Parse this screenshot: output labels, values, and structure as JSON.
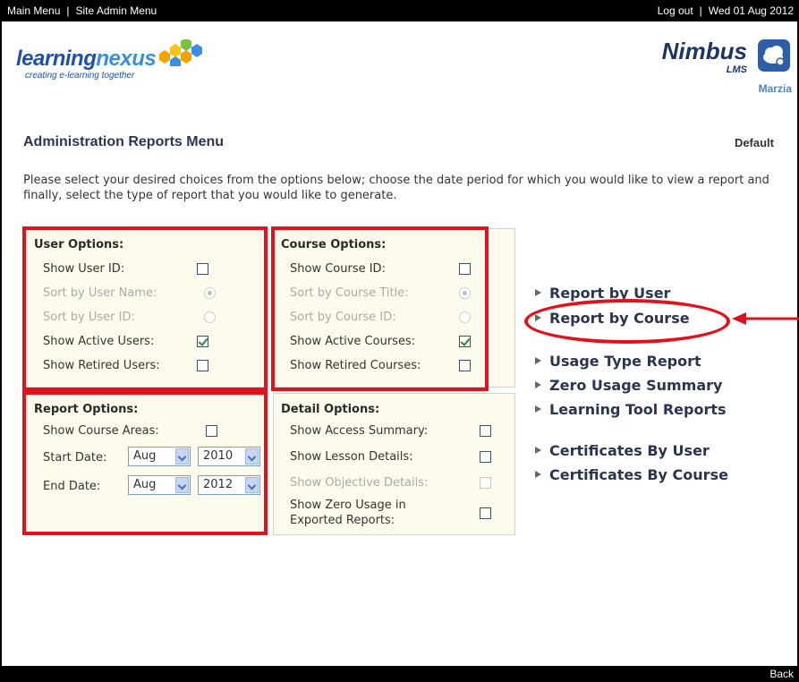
{
  "topbar": {
    "main_menu": "Main Menu",
    "site_admin_menu": "Site Admin Menu",
    "sep": "|",
    "logout": "Log out",
    "date": "Wed 01 Aug 2012"
  },
  "header": {
    "logo_part1": "learning",
    "logo_part2": "nexus",
    "logo_tagline": "creating e-learning together",
    "brand": "Nimbus",
    "brand_sub": "LMS",
    "username": "Marzia"
  },
  "page": {
    "title": "Administration Reports Menu",
    "default_label": "Default",
    "intro": "Please select your desired choices from the options below; choose the date period for which you would like to view a report and finally, select the type of report that you would like to generate."
  },
  "user_options": {
    "heading": "User Options:",
    "show_user_id": "Show User ID:",
    "sort_user_name": "Sort by User Name:",
    "sort_user_id": "Sort by User ID:",
    "show_active_users": "Show Active Users:",
    "show_retired_users": "Show Retired Users:"
  },
  "course_options": {
    "heading": "Course Options:",
    "show_course_id": "Show Course ID:",
    "sort_course_title": "Sort by Course Title:",
    "sort_course_id": "Sort by Course ID:",
    "show_active_courses": "Show Active Courses:",
    "show_retired_courses": "Show Retired Courses:"
  },
  "report_options": {
    "heading": "Report Options:",
    "show_course_areas": "Show Course Areas:",
    "start_date_label": "Start Date:",
    "start_month": "Aug",
    "start_year": "2010",
    "end_date_label": "End Date:",
    "end_month": "Aug",
    "end_year": "2012"
  },
  "detail_options": {
    "heading": "Detail Options:",
    "show_access_summary": "Show Access Summary:",
    "show_lesson_details": "Show Lesson Details:",
    "show_objective_details": "Show Objective Details:",
    "show_zero_usage_line1": "Show Zero Usage in",
    "show_zero_usage_line2": "Exported Reports:"
  },
  "reports": {
    "by_user": "Report by User",
    "by_course": "Report by Course",
    "usage_type": "Usage Type Report",
    "zero_usage": "Zero Usage Summary",
    "learning_tool": "Learning Tool Reports",
    "cert_by_user": "Certificates By User",
    "cert_by_course": "Certificates By Course"
  },
  "footer": {
    "back": "Back"
  },
  "colors": {
    "highlight": "#e4111a",
    "panel_bg": "#fdfcec",
    "check": "#2e8a2e"
  }
}
